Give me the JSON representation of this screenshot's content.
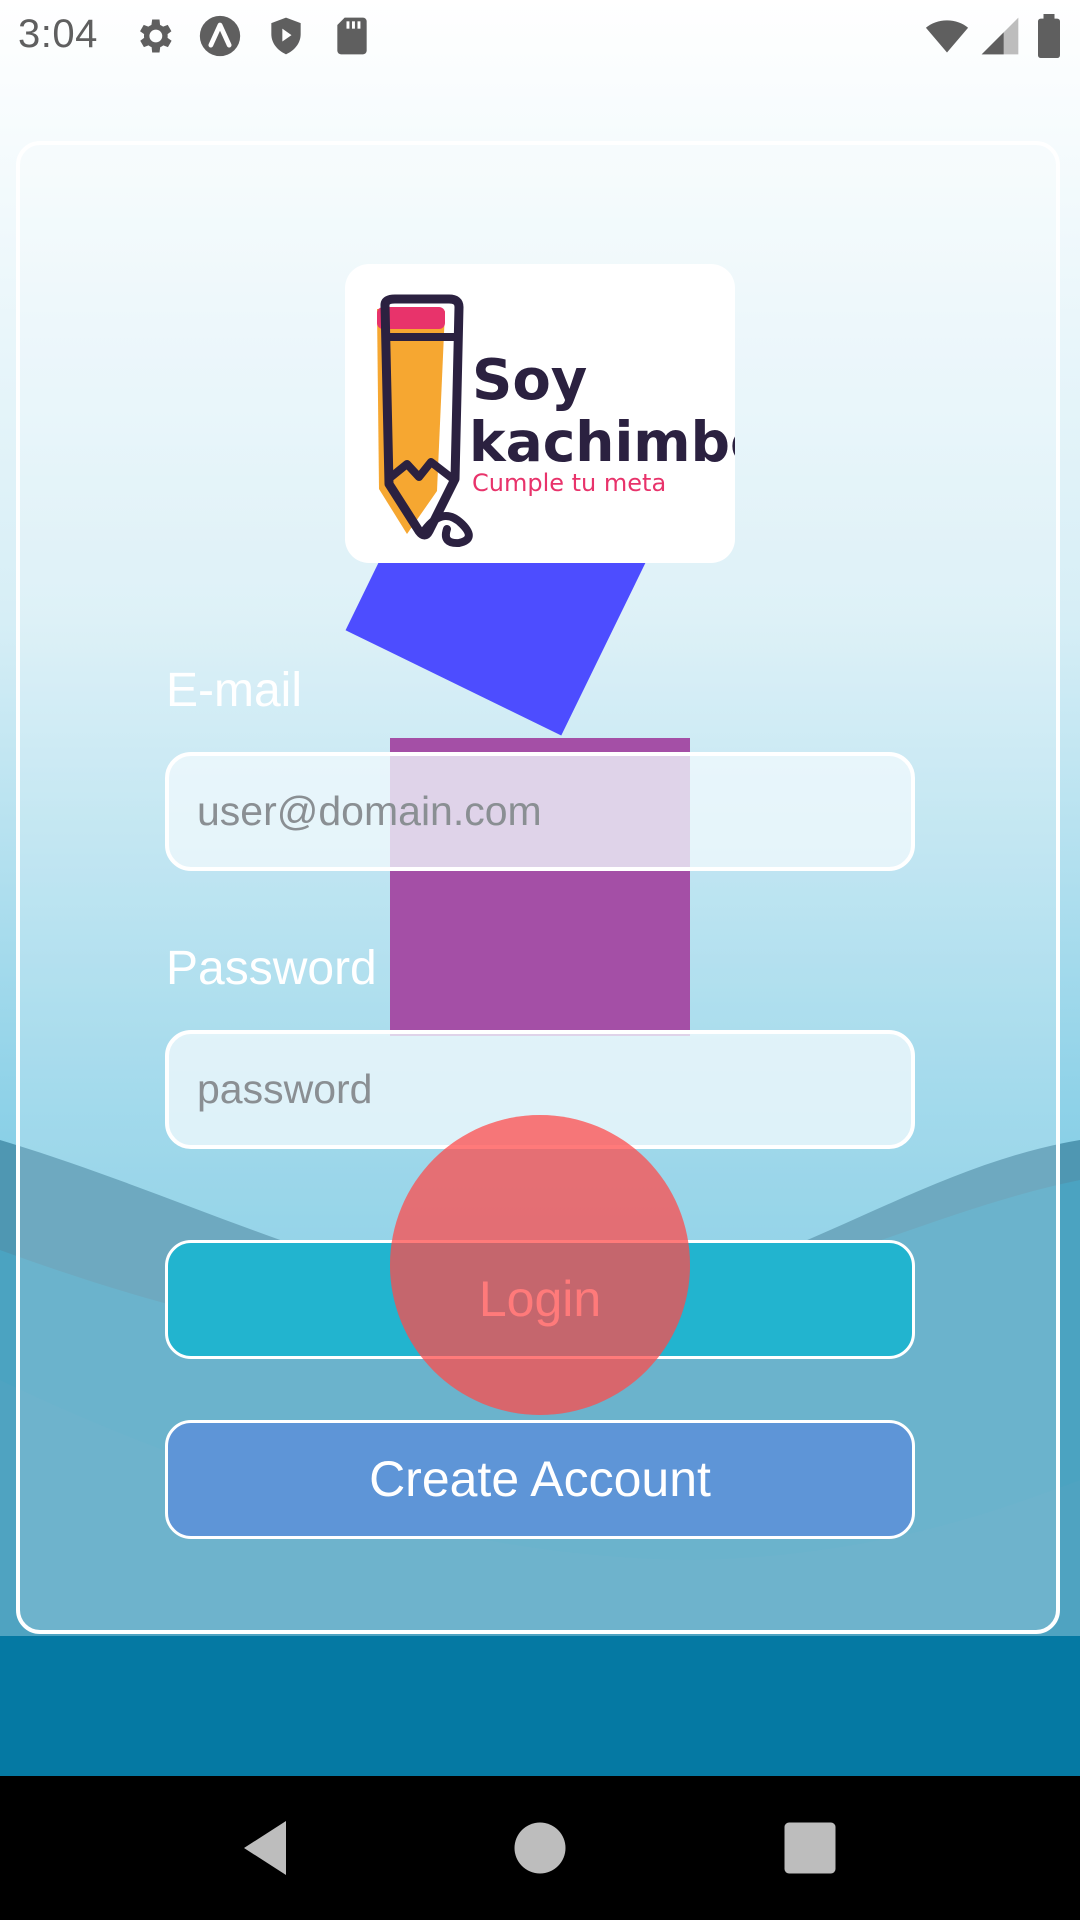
{
  "status_bar": {
    "time": "3:04",
    "left_icons": [
      "gear-icon",
      "arc-app-icon",
      "shield-play-icon",
      "sd-card-icon"
    ],
    "right_icons": [
      "wifi-icon",
      "signal-icon",
      "battery-icon"
    ]
  },
  "logo": {
    "brand_line1": "Soy",
    "brand_line2": "kachimbo",
    "tagline": "Cumple tu meta",
    "colors": {
      "pencil": "#f6a731",
      "eraser": "#e8336b",
      "ink": "#2b2140",
      "tagline": "#e8336b"
    }
  },
  "form": {
    "email_label": "E-mail",
    "email_placeholder": "user@domain.com",
    "email_value": "",
    "password_label": "Password",
    "password_placeholder": "password",
    "password_value": ""
  },
  "buttons": {
    "login": "Login",
    "create_account": "Create Account"
  },
  "nav": [
    "back-icon",
    "home-icon",
    "recents-icon"
  ],
  "colors": {
    "login_button": "#22b4cf",
    "create_button": "#5e95d7",
    "overlay_blue": "#4d4dff",
    "overlay_purple": "#a44fa6",
    "overlay_red": "#ff4b4b"
  }
}
